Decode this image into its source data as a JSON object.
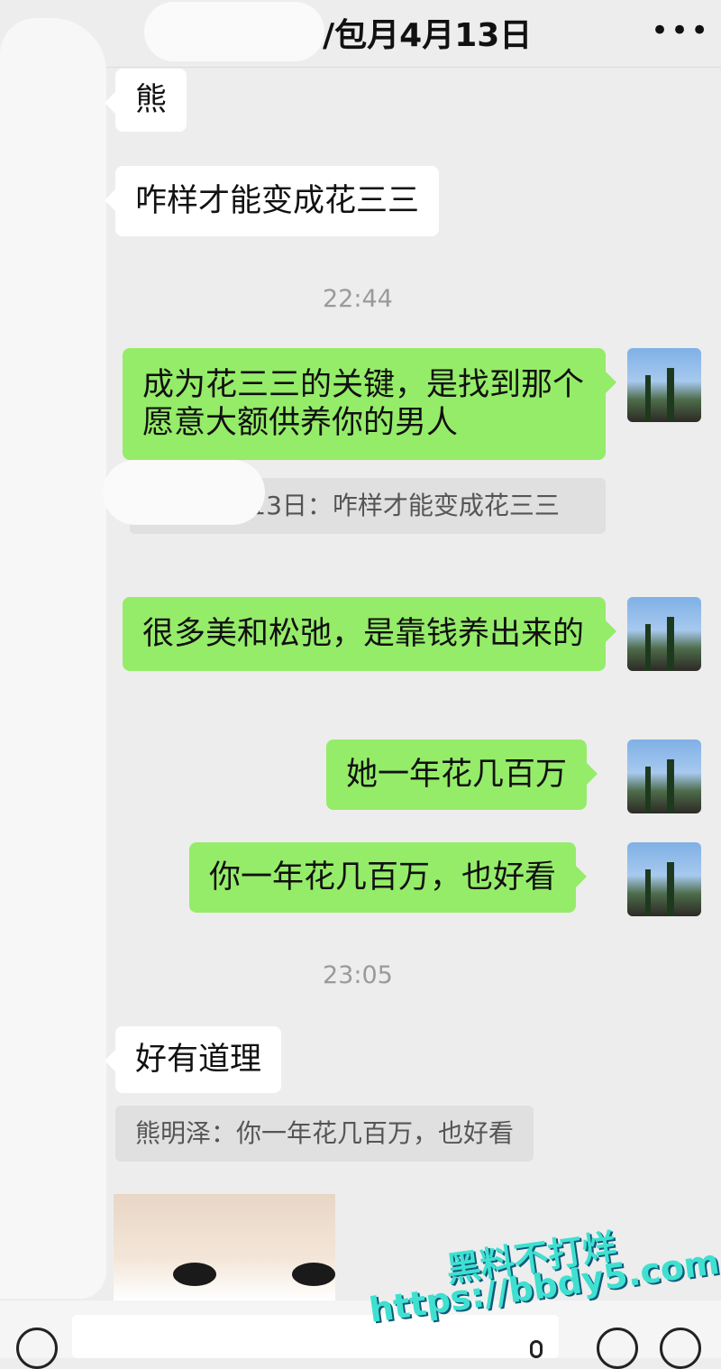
{
  "header": {
    "back_glyph": "‹",
    "title": "/包月4月13日",
    "more_glyph": "•••"
  },
  "messages": {
    "m1": "熊",
    "m2": "咋样才能变成花三三",
    "time1": "22:44",
    "m3": "成为花三三的关键，是找到那个愿意大额供养你的男人",
    "q1": "/包月4月13日：咋样才能变成花三三",
    "m4": "很多美和松弛，是靠钱养出来的",
    "m5": "她一年花几百万",
    "m6": "你一年花几百万，也好看",
    "time2": "23:05",
    "m7": "好有道理",
    "q2": "熊明泽：你一年花几百万，也好看"
  },
  "watermark": {
    "line1": "黑料不打烊",
    "line2": "https://bbdy5.com"
  },
  "colors": {
    "background": "#ededed",
    "sent_bubble": "#95ec69",
    "received_bubble": "#ffffff",
    "watermark": "#3fe0d0"
  },
  "icons": {
    "voice": "voice-icon",
    "mic": "mic-icon",
    "emoji": "emoji-icon",
    "plus": "plus-icon"
  }
}
